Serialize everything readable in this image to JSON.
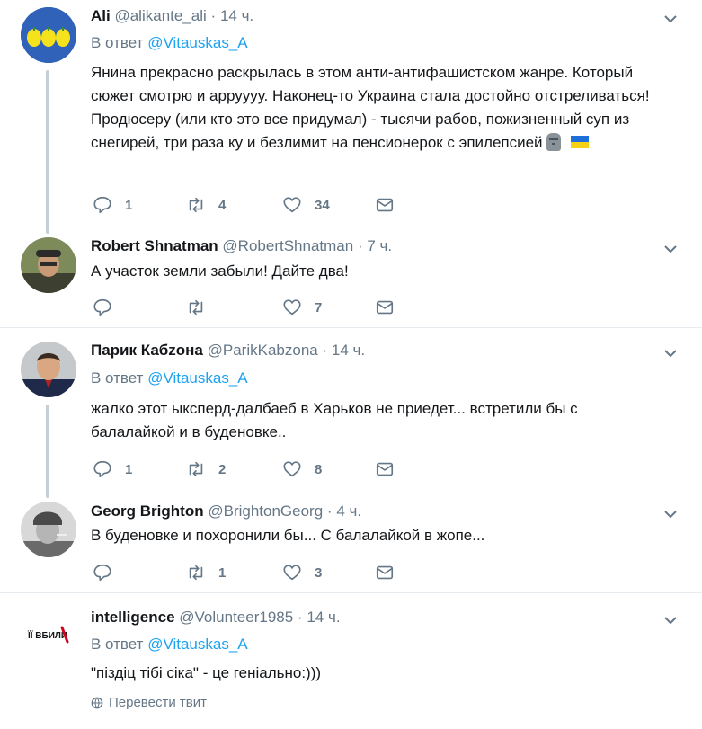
{
  "colors": {
    "link": "#1da1f2",
    "muted": "#657786",
    "text": "#14171a",
    "divider": "#e6ecf0",
    "thread": "#c4cfd6"
  },
  "tweets": [
    {
      "name": "Ali",
      "handle": "@alikante_ali",
      "dot": "·",
      "time": "14 ч.",
      "reply_prefix": "В ответ",
      "reply_to": "@Vitauskas_A",
      "text": "Янина прекрасно раскрылась в этом анти-антифашистском жанре. Который сюжет смотрю и арруууу. Наконец-то Украина стала достойно отстреливаться! Продюсеру (или кто это все придумал) - тысячи рабов, пожизненный суп из снегирей, три раза ку и безлимит на пенсионерок с эпилепсией",
      "emoji": [
        "moai-icon",
        "ukraine-flag-icon"
      ],
      "replies": "1",
      "retweets": "4",
      "likes": "34"
    },
    {
      "name": "Robert Shnatman",
      "handle": "@RobertShnatman",
      "dot": "·",
      "time": "7 ч.",
      "text": "А участок земли забыли! Дайте два!",
      "replies": "",
      "retweets": "",
      "likes": "7"
    },
    {
      "name": "Парик Кабzона",
      "handle": "@ParikKabzona",
      "dot": "·",
      "time": "14 ч.",
      "reply_prefix": "В ответ",
      "reply_to": "@Vitauskas_A",
      "text": "жалко этот ыксперд-далбаеб в Харьков не приедет... встретили бы с балалайкой и в буденовке..",
      "replies": "1",
      "retweets": "2",
      "likes": "8"
    },
    {
      "name": "Georg Brighton",
      "handle": "@BrightonGeorg",
      "dot": "·",
      "time": "4 ч.",
      "text": "В буденовке и похоронили бы... С балалайкой в жопе...",
      "replies": "",
      "retweets": "1",
      "likes": "3"
    },
    {
      "name": "intelligence",
      "handle": "@Volunteer1985",
      "dot": "·",
      "time": "14 ч.",
      "reply_prefix": "В ответ",
      "reply_to": "@Vitauskas_A",
      "avatar_text": "ЇЇ ВБИЛИ",
      "text": "\"піздіц тібі сіка\" - це геніально:)))",
      "translate_label": "Перевести твит"
    }
  ]
}
